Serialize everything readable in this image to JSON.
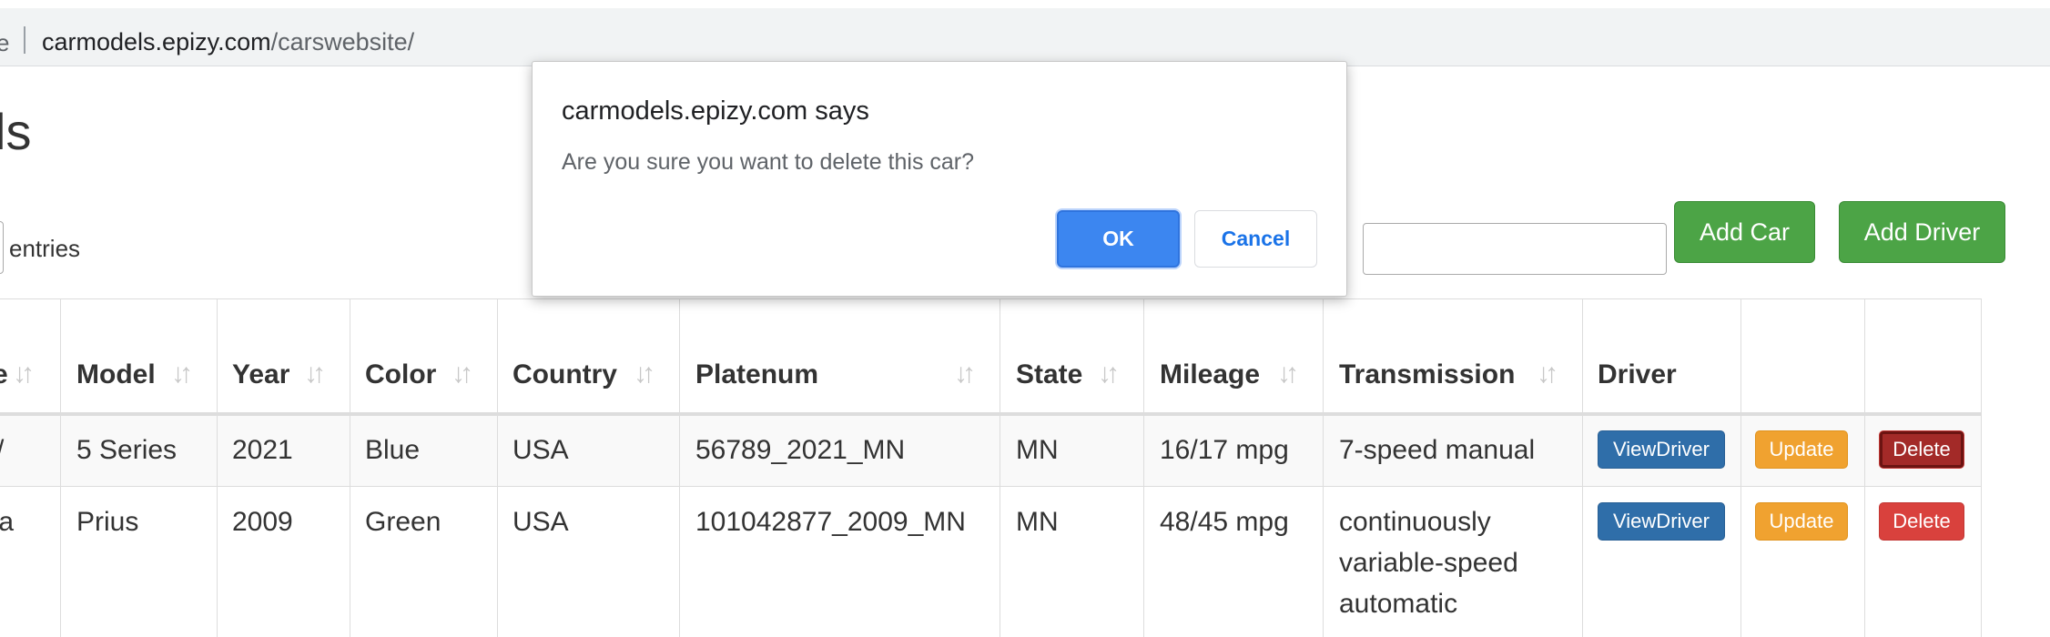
{
  "browser": {
    "address_tail": "e",
    "url_host": "carmodels.epizy.com",
    "url_path": "/carswebsite/"
  },
  "page": {
    "title": "ls",
    "entries_label": "entries",
    "search_colon": ":",
    "add_car": "Add Car",
    "add_driver": "Add Driver"
  },
  "table": {
    "headers": {
      "make": "e",
      "model": "Model",
      "year": "Year",
      "color": "Color",
      "country": "Country",
      "platenum": "Platenum",
      "state": "State",
      "mileage": "Mileage",
      "transmission": "Transmission",
      "driver": "Driver"
    },
    "sort_glyph": "↓↑",
    "rows": [
      {
        "make": "/",
        "model": "5 Series",
        "year": "2021",
        "color": "Blue",
        "country": "USA",
        "platenum": "56789_2021_MN",
        "state": "MN",
        "mileage": "16/17 mpg",
        "transmission": "7-speed manual",
        "view": "ViewDriver",
        "update": "Update",
        "delete": "Delete"
      },
      {
        "make": "ta",
        "model": "Prius",
        "year": "2009",
        "color": "Green",
        "country": "USA",
        "platenum": "101042877_2009_MN",
        "state": "MN",
        "mileage": "48/45 mpg",
        "transmission_lines": [
          "continuously",
          "variable-speed",
          "automatic"
        ],
        "view": "ViewDriver",
        "update": "Update",
        "delete": "Delete"
      }
    ]
  },
  "dialog": {
    "title": "carmodels.epizy.com says",
    "message": "Are you sure you want to delete this car?",
    "ok": "OK",
    "cancel": "Cancel"
  },
  "colors": {
    "ok_button": "#3c86f0",
    "add_button": "#4ca446",
    "view_button": "#2f6ea9",
    "update_button": "#f0a230",
    "delete_button": "#d9413d"
  }
}
